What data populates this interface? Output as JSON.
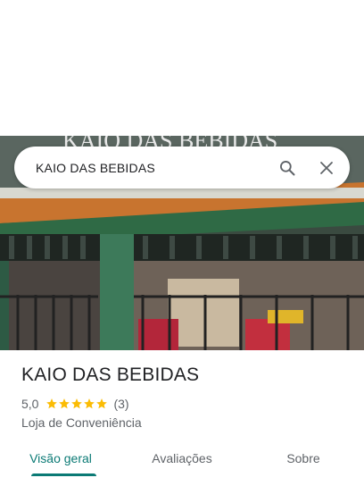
{
  "search": {
    "query": "KAIO DAS BEBIDAS"
  },
  "place": {
    "name": "KAIO DAS BEBIDAS",
    "rating": "5,0",
    "review_count": "(3)",
    "stars": 5,
    "category": "Loja de Conveniência",
    "sign_text": "KAIO DAS BEBIDAS"
  },
  "tabs": [
    {
      "label": "Visão geral",
      "active": true
    },
    {
      "label": "Avaliações",
      "active": false
    },
    {
      "label": "Sobre",
      "active": false
    }
  ],
  "colors": {
    "accent": "#0b7a75",
    "star": "#fbbc04",
    "text": "#202124",
    "secondary": "#5f6368"
  }
}
